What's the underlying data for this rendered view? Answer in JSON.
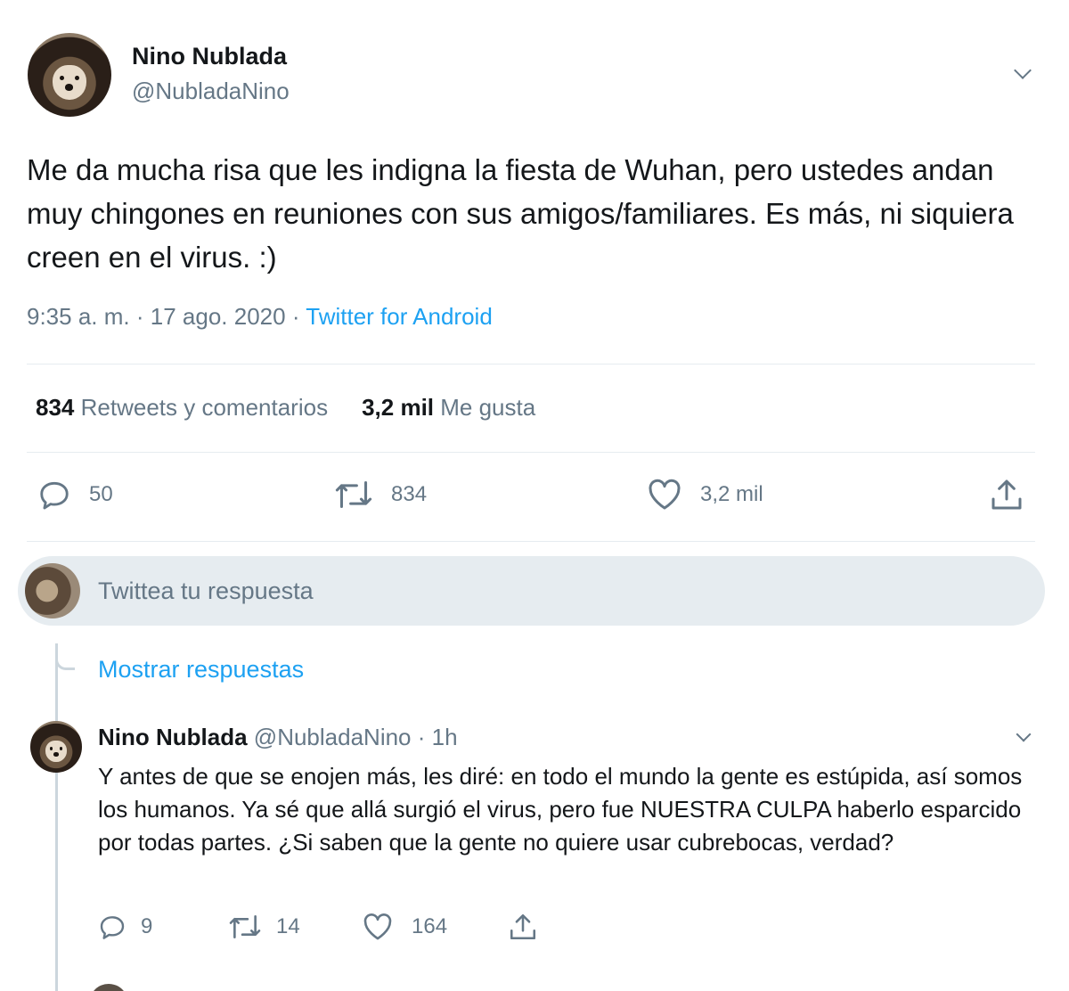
{
  "tweet": {
    "author_name": "Nino Nublada",
    "author_handle": "@NubladaNino",
    "text": "Me da mucha risa que les indigna la fiesta de Wuhan, pero ustedes andan muy chingones en reuniones con sus amigos/familiares. Es más, ni siquiera creen en el virus. :)",
    "time": "9:35 a. m.",
    "separator": "·",
    "date": "17 ago. 2020",
    "source": "Twitter for Android"
  },
  "stats": {
    "retweets_count": "834",
    "retweets_label": "Retweets y comentarios",
    "likes_count": "3,2 mil",
    "likes_label": "Me gusta"
  },
  "actions": {
    "reply_count": "50",
    "retweet_count": "834",
    "like_count": "3,2 mil",
    "icons": [
      "reply-icon",
      "retweet-icon",
      "heart-icon",
      "share-icon"
    ]
  },
  "reply_box": {
    "placeholder": "Twittea tu respuesta"
  },
  "thread": {
    "show_replies": "Mostrar respuestas"
  },
  "reply": {
    "author_name": "Nino Nublada",
    "author_handle": "@NubladaNino",
    "separator": "·",
    "time": "1h",
    "text": "Y antes de que se enojen más, les diré: en todo el mundo la gente es estúpida, así somos los humanos. Ya sé que allá surgió el virus, pero fue NUESTRA CULPA haberlo esparcido por todas partes. ¿Si saben que la gente no quiere usar cubrebocas, verdad?",
    "reply_count": "9",
    "retweet_count": "14",
    "like_count": "164"
  },
  "colors": {
    "accent": "#1da1f2",
    "secondary_text": "#657786",
    "divider": "#e6ecf0"
  }
}
